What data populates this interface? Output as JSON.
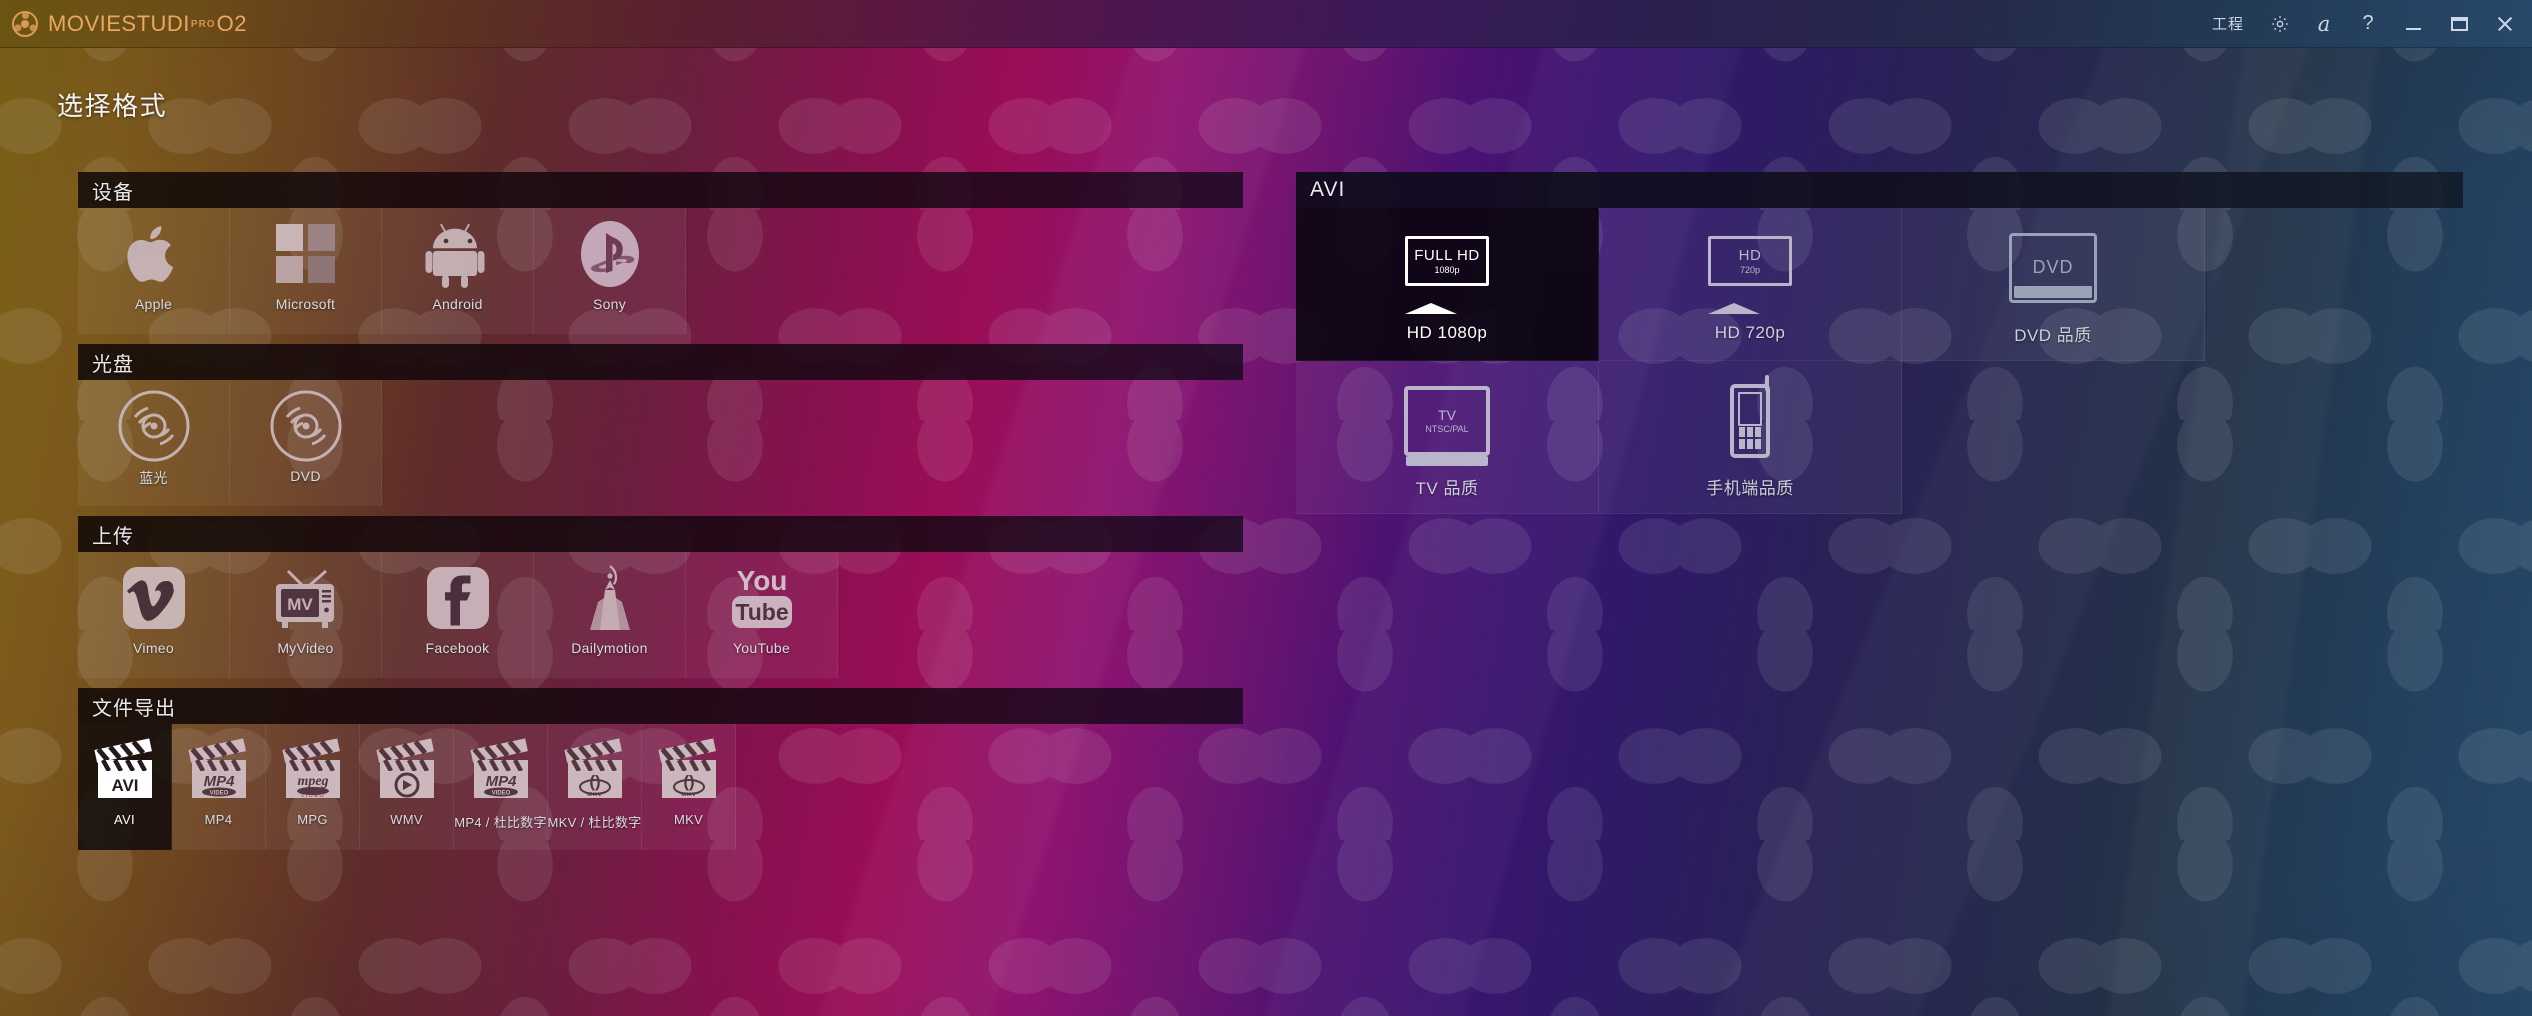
{
  "titlebar": {
    "brand_movie": "MOVIE",
    "brand_studio": "STUDI",
    "brand_pro": "PRO",
    "brand_o": "O",
    "brand_two": "2",
    "project_label": "工程",
    "settings_icon": "gear-icon",
    "font_icon": "a",
    "help_label": "?",
    "minimize_label": "",
    "maximize_label": "",
    "close_label": ""
  },
  "page": {
    "title": "选择格式"
  },
  "left": {
    "sections": [
      {
        "header": "设备",
        "tiles": [
          {
            "label": "Apple",
            "icon": "apple-icon",
            "selected": false
          },
          {
            "label": "Microsoft",
            "icon": "windows-icon",
            "selected": false
          },
          {
            "label": "Android",
            "icon": "android-icon",
            "selected": false
          },
          {
            "label": "Sony",
            "icon": "playstation-icon",
            "selected": false
          }
        ]
      },
      {
        "header": "光盘",
        "tiles": [
          {
            "label": "蓝光",
            "icon": "disc-icon",
            "selected": false
          },
          {
            "label": "DVD",
            "icon": "disc-icon",
            "selected": false
          }
        ]
      },
      {
        "header": "上传",
        "tiles": [
          {
            "label": "Vimeo",
            "icon": "vimeo-icon",
            "selected": false
          },
          {
            "label": "MyVideo",
            "icon": "myvideo-tv-icon",
            "selected": false
          },
          {
            "label": "Facebook",
            "icon": "facebook-icon",
            "selected": false
          },
          {
            "label": "Dailymotion",
            "icon": "dailymotion-icon",
            "selected": false
          },
          {
            "label": "YouTube",
            "icon": "youtube-icon",
            "selected": false
          }
        ]
      },
      {
        "header": "文件导出",
        "tiles": [
          {
            "label": "AVI",
            "icon": "clapperboard-avi-icon",
            "selected": true
          },
          {
            "label": "MP4",
            "icon": "clapperboard-mp4-icon",
            "selected": false
          },
          {
            "label": "MPG",
            "icon": "clapperboard-mpeg-icon",
            "selected": false
          },
          {
            "label": "WMV",
            "icon": "clapperboard-wmv-icon",
            "selected": false
          },
          {
            "label": "MP4 / 杜比数字",
            "icon": "clapperboard-mp4-icon",
            "selected": false
          },
          {
            "label": "MKV / 杜比数字",
            "icon": "clapperboard-mkv-icon",
            "selected": false
          },
          {
            "label": "MKV",
            "icon": "clapperboard-mkv-icon",
            "selected": false
          }
        ]
      }
    ]
  },
  "right": {
    "header": "AVI",
    "tiles": [
      {
        "label": "HD 1080p",
        "icon": "monitor-icon",
        "icon_line1": "FULL HD",
        "icon_line2": "1080p",
        "selected": true
      },
      {
        "label": "HD 720p",
        "icon": "monitor-icon",
        "icon_line1": "HD",
        "icon_line2": "720p",
        "selected": false
      },
      {
        "label": "DVD 品质",
        "icon": "dvd-tv-icon",
        "icon_line1": "DVD",
        "icon_line2": "",
        "selected": false
      },
      {
        "label": "TV 品质",
        "icon": "crt-tv-icon",
        "icon_line1": "TV",
        "icon_line2": "NTSC/PAL",
        "selected": false
      },
      {
        "label": "手机端品质",
        "icon": "mobile-icon",
        "icon_line1": "",
        "icon_line2": "",
        "selected": false
      }
    ]
  },
  "colors": {
    "accent": "#e8a860",
    "selected_bg": "#0c080e",
    "text_primary": "#f2f3f6",
    "bg_left": "#7a6016",
    "bg_mid": "#9a0e57",
    "bg_right": "#27496a"
  }
}
